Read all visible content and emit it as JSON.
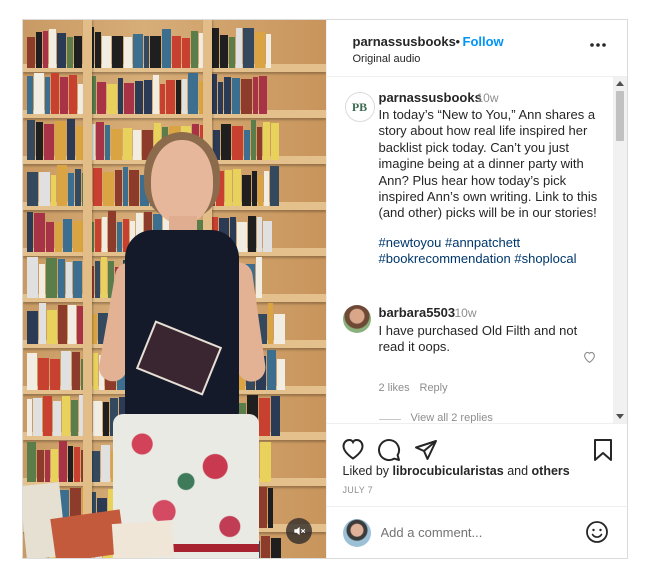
{
  "header": {
    "username": "parnassusbooks",
    "separator": "•",
    "follow_label": "Follow",
    "audio_label": "Original audio",
    "more_icon": "more-horizontal-icon"
  },
  "caption": {
    "avatar_initials": "PB",
    "username": "parnassusbooks",
    "time": "10w",
    "text": "In today’s “New to You,” Ann shares a story about how real life inspired her backlist pick today. Can’t you just imagine being at a dinner party with Ann? Plus hear how today’s pick inspired Ann’s own writing. Link to this (and other) picks will be in our stories!",
    "hashtags": "#newtoyou #annpatchett #bookrecommendation #shoplocal"
  },
  "comment": {
    "username": "barbara5503",
    "time": "10w",
    "text": "I have purchased Old Filth and not read it oops.",
    "likes": "2 likes",
    "reply": "Reply",
    "view_replies": "View all 2 replies"
  },
  "actions": {
    "icons": [
      "heart-icon",
      "comment-icon",
      "share-icon",
      "bookmark-icon"
    ]
  },
  "liked_by": {
    "prefix": "Liked by",
    "user": "librocubicularistas",
    "middle": "and",
    "others": "others"
  },
  "date": "JULY 7",
  "add_comment": {
    "placeholder": "Add a comment..."
  },
  "colors": {
    "follow_blue": "#0095f6",
    "hashtag_blue": "#00376b",
    "muted_gray": "#8e8e8e"
  }
}
